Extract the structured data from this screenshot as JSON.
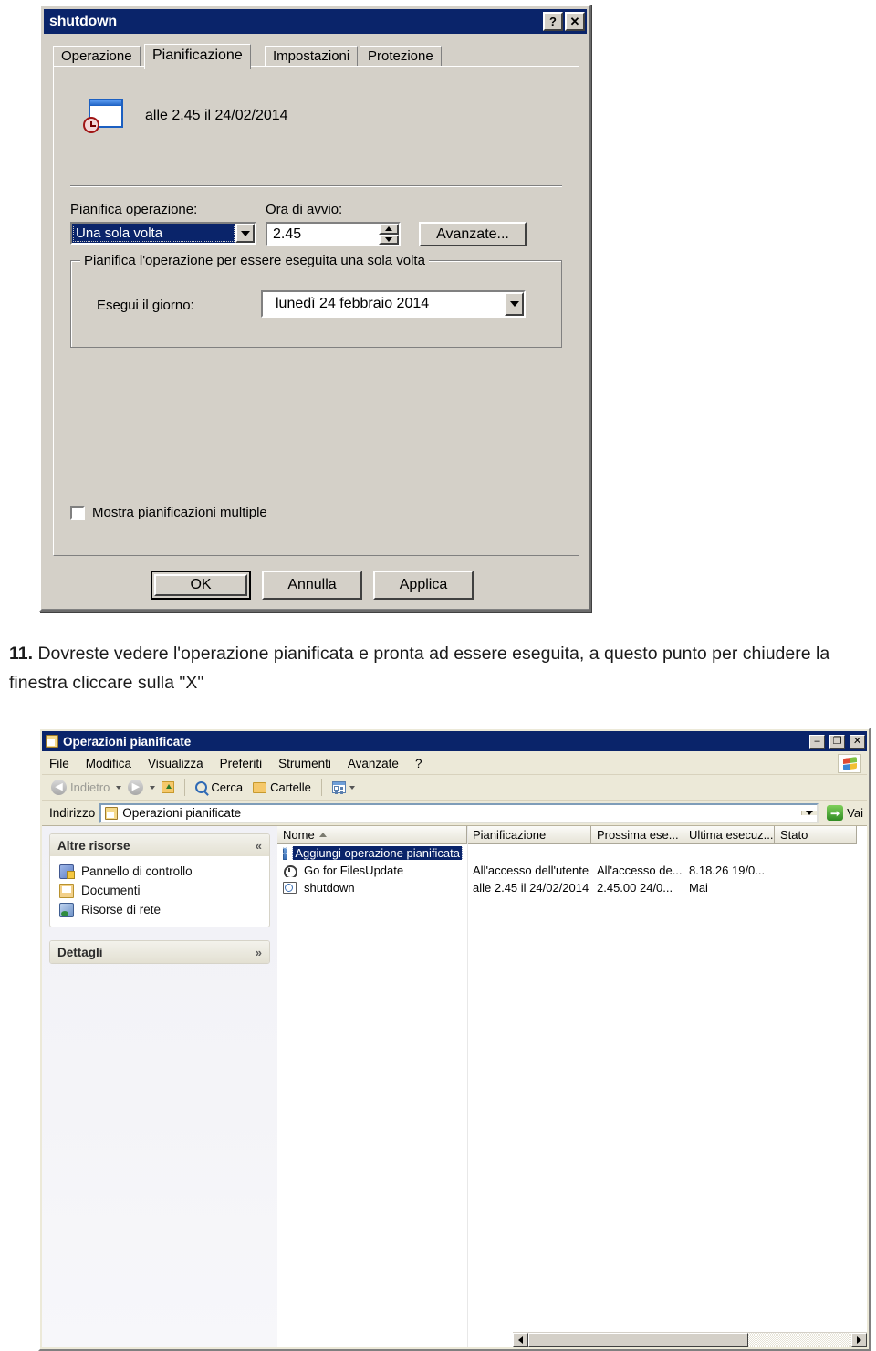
{
  "dialog": {
    "title": "shutdown",
    "help_button": "?",
    "close_button": "✕",
    "tabs": [
      {
        "label": "Operazione",
        "active": false
      },
      {
        "label": "Pianificazione",
        "active": true
      },
      {
        "label": "Impostazioni",
        "active": false
      },
      {
        "label": "Protezione",
        "active": false
      }
    ],
    "summary": "alle 2.45 il 24/02/2014",
    "schedule_label": "Pianifica operazione:",
    "schedule_value": "Una sola volta",
    "start_time_label": "Ora di avvio:",
    "start_time_value": "2.45",
    "advanced_button": "Avanzate...",
    "group_title": "Pianifica l'operazione per essere eseguita una sola volta",
    "run_day_label": "Esegui il giorno:",
    "run_day_value": "lunedì   24   febbraio   2014",
    "multiple_checkbox_label": "Mostra pianificazioni multiple",
    "multiple_checkbox_checked": false,
    "ok_button": "OK",
    "cancel_button": "Annulla",
    "apply_button": "Applica"
  },
  "instruction": {
    "number": "11.",
    "text": "Dovreste vedere l'operazione pianificata e pronta ad essere eseguita, a questo punto per chiudere la finestra cliccare sulla \"X\""
  },
  "explorer": {
    "title": "Operazioni pianificate",
    "minimize_button": "–",
    "maximize_button": "❐",
    "close_button": "✕",
    "menu": [
      "File",
      "Modifica",
      "Visualizza",
      "Preferiti",
      "Strumenti",
      "Avanzate",
      "?"
    ],
    "toolbar": {
      "back_label": "Indietro",
      "forward_label": "",
      "up_label": "",
      "search_label": "Cerca",
      "folders_label": "Cartelle",
      "views_label": ""
    },
    "address": {
      "label": "Indirizzo",
      "value": "Operazioni pianificate",
      "go_label": "Vai"
    },
    "sidebar": {
      "panels": [
        {
          "title": "Altre risorse",
          "chevron": "«",
          "items": [
            {
              "label": "Pannello di controllo",
              "icon": "control-panel-icon"
            },
            {
              "label": "Documenti",
              "icon": "documents-icon"
            },
            {
              "label": "Risorse di rete",
              "icon": "network-icon"
            }
          ]
        },
        {
          "title": "Dettagli",
          "chevron": "»",
          "items": []
        }
      ]
    },
    "list": {
      "columns": [
        "Nome",
        "Pianificazione",
        "Prossima ese...",
        "Ultima esecuz...",
        "Stato"
      ],
      "sort_column": "Nome",
      "sort_direction": "asc",
      "rows": [
        {
          "icon": "add-task-icon",
          "name": "Aggiungi operazione pianificata",
          "schedule": "",
          "next_run": "",
          "last_run": "",
          "status": "",
          "selected": true
        },
        {
          "icon": "task-icon",
          "name": "Go for FilesUpdate",
          "schedule": "All'accesso dell'utente",
          "next_run": "All'accesso de...",
          "last_run": "8.18.26  19/0...",
          "status": "",
          "selected": false
        },
        {
          "icon": "shutdown-task-icon",
          "name": "shutdown",
          "schedule": "alle 2.45 il 24/02/2014",
          "next_run": "2.45.00  24/0...",
          "last_run": "Mai",
          "status": "",
          "selected": false
        }
      ]
    },
    "scrollbar": {
      "left_arrow": "◄",
      "right_arrow": "►"
    }
  },
  "colors": {
    "titlebar": "#0a246a",
    "dialog_face": "#d4d0c8",
    "explorer_face": "#ece9d8",
    "selection": "#0a246a"
  }
}
